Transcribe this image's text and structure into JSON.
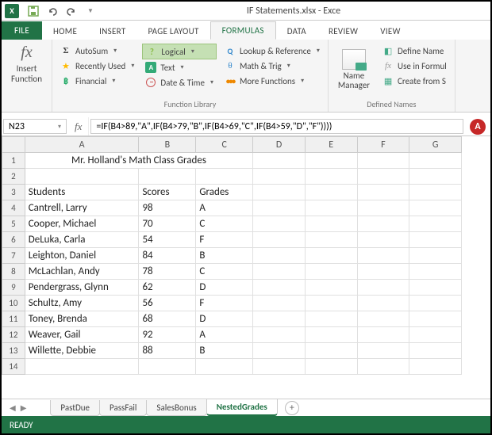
{
  "titlebar": {
    "title": "IF Statements.xlsx - Exce"
  },
  "tabs": {
    "file": "FILE",
    "home": "HOME",
    "insert": "INSERT",
    "page_layout": "PAGE LAYOUT",
    "formulas": "FORMULAS",
    "data": "DATA",
    "review": "REVIEW",
    "view": "VIEW"
  },
  "ribbon": {
    "insert_function": "Insert\nFunction",
    "autosum": "AutoSum",
    "recent": "Recently Used",
    "financial": "Financial",
    "logical": "Logical",
    "text": "Text",
    "date_time": "Date & Time",
    "lookup": "Lookup & Reference",
    "math_trig": "Math & Trig",
    "more": "More Functions",
    "group_library": "Function Library",
    "name_manager": "Name\nManager",
    "define_name": "Define Name",
    "use_in_formula": "Use in Formul",
    "create_from": "Create from S",
    "group_names": "Defined Names"
  },
  "formula_bar": {
    "cell_ref": "N23",
    "formula": "=IF(B4>89,\"A\",IF(B4>79,\"B\",IF(B4>69,\"C\",IF(B4>59,\"D\",\"F\"))))",
    "badge": "A"
  },
  "columns": [
    "A",
    "B",
    "C",
    "D",
    "E",
    "F",
    "G"
  ],
  "sheet_title": "Mr. Holland's Math Class Grades",
  "headers": {
    "col_a": "Students",
    "col_b": "Scores",
    "col_c": "Grades"
  },
  "rows": [
    {
      "n": 4,
      "a": "Cantrell, Larry",
      "b": "98",
      "c": "A"
    },
    {
      "n": 5,
      "a": "Cooper, Michael",
      "b": "70",
      "c": "C"
    },
    {
      "n": 6,
      "a": "DeLuka, Carla",
      "b": "54",
      "c": "F"
    },
    {
      "n": 7,
      "a": "Leighton, Daniel",
      "b": "84",
      "c": "B"
    },
    {
      "n": 8,
      "a": "McLachlan, Andy",
      "b": "78",
      "c": "C"
    },
    {
      "n": 9,
      "a": "Pendergrass, Glynn",
      "b": "62",
      "c": "D"
    },
    {
      "n": 10,
      "a": "Schultz, Amy",
      "b": "56",
      "c": "F"
    },
    {
      "n": 11,
      "a": "Toney, Brenda",
      "b": "68",
      "c": "D"
    },
    {
      "n": 12,
      "a": "Weaver, Gail",
      "b": "92",
      "c": "A"
    },
    {
      "n": 13,
      "a": "Willette, Debbie",
      "b": "88",
      "c": "B"
    }
  ],
  "sheet_tabs": {
    "pastdue": "PastDue",
    "passfail": "PassFail",
    "salesbonus": "SalesBonus",
    "nestedgrades": "NestedGrades"
  },
  "status": "READY"
}
